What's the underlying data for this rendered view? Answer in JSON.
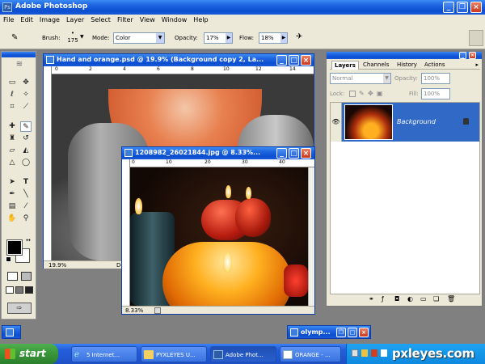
{
  "app": {
    "title": "Adobe Photoshop"
  },
  "menu": [
    "File",
    "Edit",
    "Image",
    "Layer",
    "Select",
    "Filter",
    "View",
    "Window",
    "Help"
  ],
  "options": {
    "brush_label": "Brush:",
    "brush_size": "175",
    "mode_label": "Mode:",
    "mode_value": "Color",
    "opacity_label": "Opacity:",
    "opacity_value": "17%",
    "flow_label": "Flow:",
    "flow_value": "18%"
  },
  "doc1": {
    "title": "Hand and orange.psd @ 19.9% (Background copy 2, La...",
    "zoom": "19.9%",
    "status": "Do",
    "ruler": [
      "0",
      "2",
      "4",
      "6",
      "8",
      "10",
      "12",
      "14"
    ]
  },
  "doc2": {
    "title": "1208982_26021844.jpg @ 8.33%...",
    "zoom": "8.33%",
    "ruler": [
      "0",
      "10",
      "20",
      "30",
      "40"
    ]
  },
  "layers": {
    "tabs": [
      "Layers",
      "Channels",
      "History",
      "Actions"
    ],
    "blend_mode": "Normal",
    "opacity_label": "Opacity:",
    "opacity_value": "100%",
    "lock_label": "Lock:",
    "fill_label": "Fill:",
    "fill_value": "100%",
    "layer_name": "Background"
  },
  "minimized": {
    "label": "olymp..."
  },
  "taskbar": {
    "start": "start",
    "items": [
      "5 Internet...",
      "PYXLEYES U...",
      "Adobe Phot...",
      "ORANGE - ..."
    ],
    "watermark": "pxleyes.com"
  },
  "colors": {
    "title_bar": "#0b4fd2",
    "taskbar": "#245edb",
    "start": "#3c9a3c",
    "layer_selected": "#3169c6"
  }
}
